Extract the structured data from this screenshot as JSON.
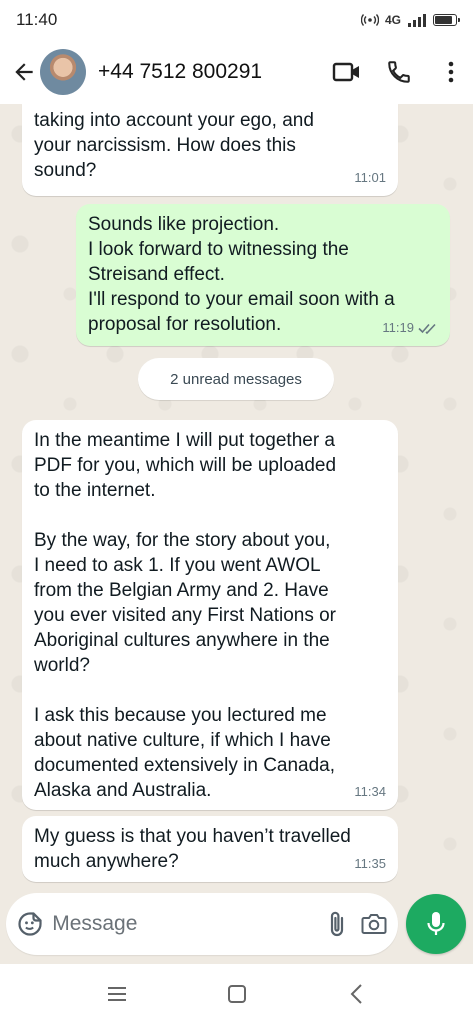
{
  "status_bar": {
    "time": "11:40",
    "network": "4G",
    "battery_level": 0.85
  },
  "header": {
    "contact_name": "+44 7512 800291",
    "icons": [
      "back-arrow-icon",
      "avatar",
      "video-call-icon",
      "phone-icon",
      "more-vert-icon"
    ]
  },
  "messages": [
    {
      "direction": "incoming",
      "text": "taking into account your ego, and\nyour narcissism. How does this\nsound?",
      "time": "11:01"
    },
    {
      "direction": "outgoing",
      "text": "Sounds like projection.\nI look forward to witnessing the\nStreisand effect.\nI'll respond to your email soon with a\nproposal for resolution.",
      "time": "11:19",
      "status": "read"
    },
    {
      "direction": "incoming",
      "text": "In the meantime I will put together a\nPDF for you, which will be uploaded\nto the internet.\n\nBy the way, for the story about you,\nI need to ask 1. If you went AWOL\nfrom the Belgian Army and 2. Have\nyou ever visited any First Nations or\nAboriginal cultures anywhere in the\nworld?\n\nI ask this because you lectured me\nabout native culture, if which I have\ndocumented extensively in Canada,\nAlaska and Australia.",
      "time": "11:34"
    },
    {
      "direction": "incoming",
      "text": "My guess is that you haven’t travelled\nmuch anywhere?",
      "time": "11:35"
    }
  ],
  "unread_label": "2 unread messages",
  "composer": {
    "placeholder": "Message"
  },
  "colors": {
    "outgoing_bubble": "#d9fdd3",
    "incoming_bubble": "#ffffff",
    "chat_background": "#efeae2",
    "mic_button": "#1daa61"
  }
}
